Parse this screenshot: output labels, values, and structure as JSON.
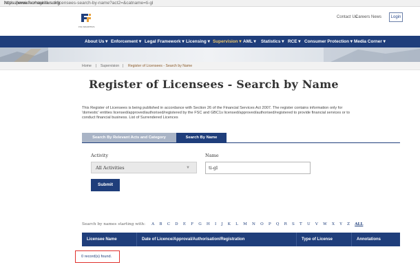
{
  "browser": {
    "url_host": "https://www.fscmauritius.org",
    "url_path": "/en/supervision/register-of-licensees-search-by-name?act2=&catname=ti-gl"
  },
  "header": {
    "logo_caption": "FSC MAURITIUS",
    "links": [
      "Contact Us",
      "Careers",
      "News"
    ],
    "login_label": "Login"
  },
  "nav": {
    "items": [
      "About Us ▾",
      "Enforcement ▾",
      "Legal Framework ▾",
      "Licensing ▾",
      "Supervision ▾",
      "AML ▾",
      "Statistics ▾",
      "RCE ▾",
      "Consumer Protection ▾",
      "Media Corner ▾"
    ],
    "active_index": 4
  },
  "breadcrumb": {
    "items": [
      "Home",
      "|",
      "Supervision",
      "|",
      "Register of Licensees - Search by Name"
    ]
  },
  "page": {
    "title": "Register of Licensees - Search by Name",
    "intro": "This Register of Licensees is being published in accordance with Section 26 of the Financial Services Act 2007. The register contains information only for 'domestic' entities licensed/approved/authorised/registered by the FSC and GBC1s licensed/approved/authorised/registered to provide financial services or to conduct financial business. List of Surrendered Licences"
  },
  "tabs": {
    "items": [
      "Search By Relevant Acts and Category",
      "Search By Name"
    ],
    "active_index": 1
  },
  "form": {
    "activity_label": "Activity",
    "activity_value": "All Activities",
    "name_label": "Name",
    "name_value": "ti-gl",
    "submit_label": "Submit"
  },
  "alphabet": {
    "label": "Search by names starting with:",
    "letters": [
      "A",
      "B",
      "C",
      "D",
      "E",
      "F",
      "G",
      "H",
      "I",
      "J",
      "K",
      "L",
      "M",
      "N",
      "O",
      "P",
      "Q",
      "R",
      "S",
      "T",
      "U",
      "V",
      "W",
      "X",
      "Y",
      "Z"
    ],
    "all_label": "ALL"
  },
  "results": {
    "columns": [
      "Licensee Name",
      "Date of Licence/Approval/Authorisation/Registration",
      "Type of License",
      "Annotations"
    ],
    "status": "0 record(s) found."
  },
  "colors": {
    "brand_navy": "#1f3e7b",
    "tab_inactive": "#a9b4c6",
    "nav_active": "#f0c96a",
    "highlight_red": "#e0302c"
  }
}
